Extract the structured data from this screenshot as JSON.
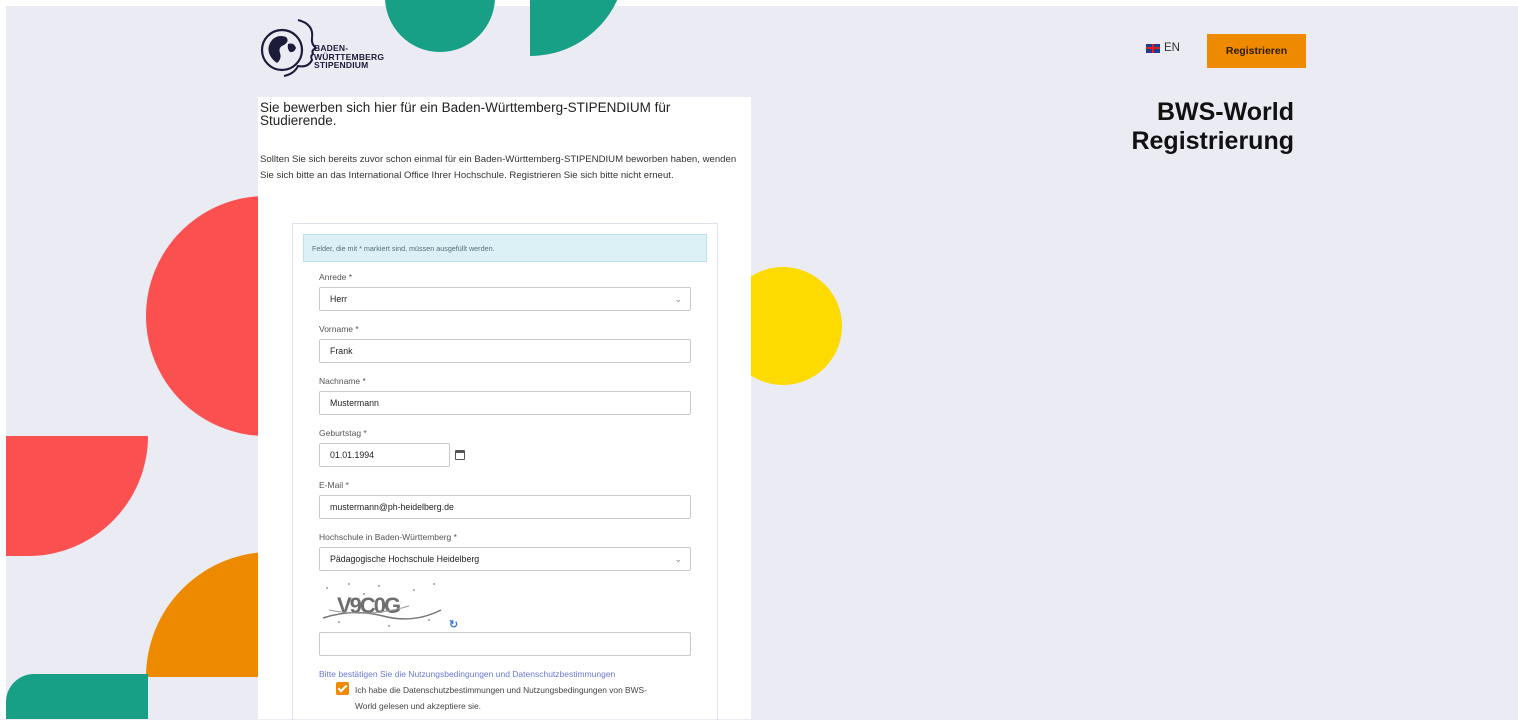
{
  "logo": {
    "lines": [
      "BADEN-",
      "WÜRTTEMBERG",
      "STIPENDIUM"
    ],
    "icon": "globe-profile-logo"
  },
  "header": {
    "language": "EN",
    "language_icon": "uk-flag-icon",
    "register_label": "Registrieren",
    "accent_color": "#ee8a00"
  },
  "heading": {
    "line1": "BWS-World",
    "line2": "Registrierung"
  },
  "intro": {
    "title": "Sie bewerben sich hier für ein Baden-Württemberg-STIPENDIUM für Studierende.",
    "text": "Sollten Sie sich bereits zuvor schon einmal für ein Baden-Württemberg-STIPENDIUM beworben haben, wenden Sie sich bitte an das International Office Ihrer Hochschule. Registrieren Sie sich bitte nicht erneut."
  },
  "form": {
    "notice": "Felder, die mit * markiert sind, müssen ausgefüllt werden.",
    "salutation": {
      "label": "Anrede *",
      "value": "Herr"
    },
    "first_name": {
      "label": "Vorname *",
      "value": "Frank"
    },
    "last_name": {
      "label": "Nachname *",
      "value": "Mustermann"
    },
    "birthday": {
      "label": "Geburtstag *",
      "value": "01.01.1994"
    },
    "email": {
      "label": "E-Mail *",
      "value": "mustermann@ph-heidelberg.de"
    },
    "university": {
      "label": "Hochschule in Baden-Württemberg *",
      "value": "Pädagogische Hochschule Heidelberg"
    },
    "captcha": {
      "text": "V9C0G",
      "input_value": ""
    },
    "terms_prompt": "Bitte bestätigen Sie die Nutzungsbedingungen und Datenschutzbestimmungen",
    "terms_checkbox": "Ich habe die Datenschutzbestimmungen und Nutzungsbedingungen von BWS-World gelesen und akzeptiere sie.",
    "terms_checked": true
  },
  "colors": {
    "red": "#fb5050",
    "green": "#17a085",
    "yellow": "#fedb00",
    "orange": "#ee8a00"
  }
}
